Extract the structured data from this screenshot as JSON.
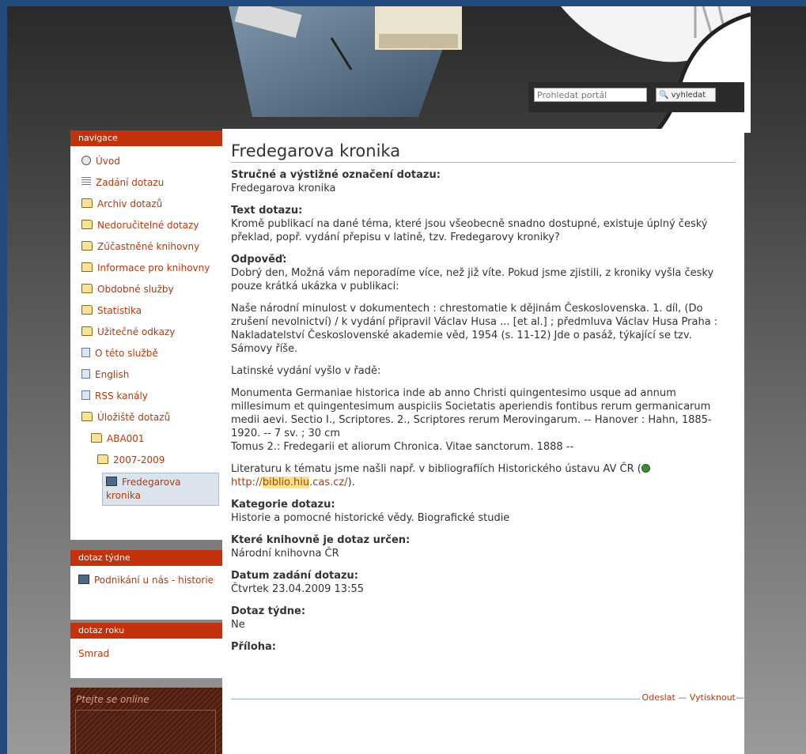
{
  "search": {
    "placeholder": "Prohledat portál",
    "button_label": "vyhledat"
  },
  "navigation": {
    "title": "navigace",
    "items": [
      {
        "label": "Úvod",
        "icon": "home-icon"
      },
      {
        "label": "Zadání dotazu",
        "icon": "form-icon"
      },
      {
        "label": "Archiv dotazů",
        "icon": "folder-icon"
      },
      {
        "label": "Nedoručitelné dotazy",
        "icon": "folder-icon"
      },
      {
        "label": "Zúčastněné knihovny",
        "icon": "folder-icon"
      },
      {
        "label": "Informace pro knihovny",
        "icon": "folder-icon"
      },
      {
        "label": "Obdobné služby",
        "icon": "folder-icon"
      },
      {
        "label": "Statistika",
        "icon": "folder-icon"
      },
      {
        "label": "Užitečné odkazy",
        "icon": "folder-icon"
      },
      {
        "label": "O této službě",
        "icon": "document-icon"
      },
      {
        "label": "English",
        "icon": "document-icon"
      },
      {
        "label": "RSS kanály",
        "icon": "document-icon"
      },
      {
        "label": "Úložiště dotazů",
        "icon": "folder-icon"
      },
      {
        "label": "ABA001",
        "icon": "folder-icon"
      },
      {
        "label": "2007-2009",
        "icon": "folder-icon"
      },
      {
        "label": "Fredegarova kronika",
        "icon": "person-icon"
      }
    ]
  },
  "week_question": {
    "title": "dotaz týdne",
    "item": "Podnikání u nás - historie"
  },
  "year_question": {
    "title": "dotaz roku",
    "item": "Smrad"
  },
  "chat": {
    "title": "Ptejte se online"
  },
  "article": {
    "title": "Fredegarova kronika",
    "short_label": "Stručné a výstižné označení dotazu:",
    "short_value": "Fredegarova kronika",
    "text_label": "Text dotazu:",
    "text_value": "Kromě publikací na dané téma, které jsou všeobecně snadno dostupné, existuje úplný český překlad, popř. vydání přepisu v latině, tzv. Fredegarovy kroniky?",
    "answer_label": "Odpověď:",
    "answer_p1": "Dobrý den, Možná vám neporadíme více, než již víte. Pokud jsme zjistili, z kroniky vyšla česky pouze krátká ukázka v publikaci:",
    "answer_p2": "Naše národní minulost v dokumentech : chrestomatie k dějinám Československa. 1. díl, (Do zrušení nevolnictví) / k vydání připravil Václav Husa ... [et al.] ; předmluva Václav Husa Praha : Nakladatelství Československé akademie věd, 1954 (s. 11-12) Jde o pasáž, týkající se tzv. Sámovy říše.",
    "answer_p3": "Latinské vydání vyšlo v řadě:",
    "answer_p4a": "Monumenta Germaniae historica inde ab anno Christi quingentesimo usque ad annum millesimum et quingentesimum auspiciis Societatis aperiendis fontibus rerum germanicarum medii aevi. Sectio I., Scriptores. 2., Scriptores rerum Merovingarum. -- Hanover : Hahn, 1885-1920. -- 7 sv. ; 30 cm",
    "answer_p4b": "Tomus 2.: Fredegarii et aliorum Chronica. Vitae sanctorum. 1888 --",
    "answer_p5_prefix": "Literaturu k tématu jsme našli např. v bibliografiích Historického ústavu AV ČR (",
    "link_pre": "http://",
    "link_hl": "biblio.hiu",
    "link_post": ".cas.cz/",
    "answer_p5_suffix": ").",
    "category_label": "Kategorie dotazu:",
    "category_value": "Historie a pomocné historické vědy. Biografické studie",
    "library_label": "Které knihovně je dotaz určen:",
    "library_value": "Národní knihovna ČR",
    "date_label": "Datum zadání dotazu:",
    "date_value": "Čtvrtek 23.04.2009 13:55",
    "week_label": "Dotaz týdne:",
    "week_value": "Ne",
    "attachment_label": "Příloha:"
  },
  "footer_actions": {
    "send": "Odeslat",
    "print": "Vytisknout",
    "sep": "—"
  }
}
